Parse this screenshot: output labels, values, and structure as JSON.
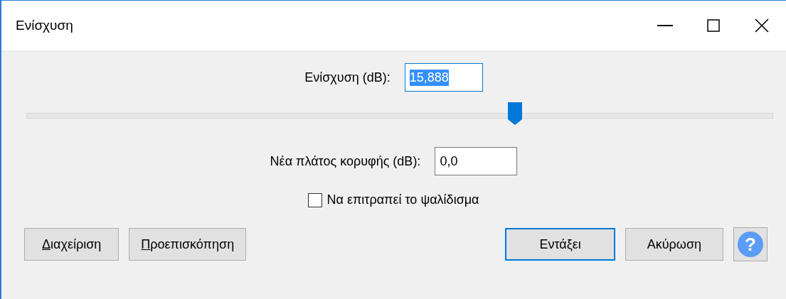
{
  "window": {
    "title": "Ενίσχυση",
    "controls": [
      {
        "kind": "minimize"
      },
      {
        "kind": "maximize"
      },
      {
        "kind": "close"
      }
    ]
  },
  "amplification": {
    "label": "Ενίσχυση (dB):",
    "value": "15,888",
    "text_selected": true
  },
  "slider": {
    "level": 0.655
  },
  "peak": {
    "label": "Νέα πλάτος κορυφής (dB):",
    "value": "0,0"
  },
  "clipping": {
    "label": "Να επιτραπεί το ψαλίδισμα",
    "checked": false
  },
  "buttons": [
    {
      "label": "Διαχείριση",
      "kind": "mnemonic",
      "default": false
    },
    {
      "label": "Προεπισκόπηση",
      "kind": "mnemonic",
      "default": false
    },
    {
      "label": "Εντάξει",
      "kind": "plain",
      "default": true
    },
    {
      "label": "Ακύρωση",
      "kind": "plain",
      "default": false
    }
  ],
  "help": {
    "label": "?"
  }
}
